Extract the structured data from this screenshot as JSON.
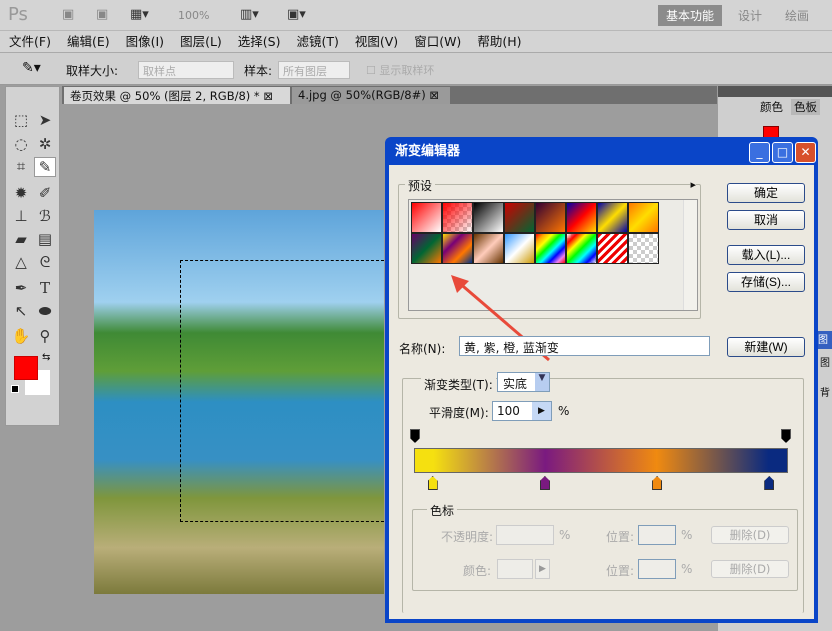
{
  "topbar": {
    "logo": "Ps",
    "zoom": "100%",
    "workspaces": [
      "基本功能",
      "设计",
      "绘画"
    ]
  },
  "menu": [
    "文件(F)",
    "编辑(E)",
    "图像(I)",
    "图层(L)",
    "选择(S)",
    "滤镜(T)",
    "视图(V)",
    "窗口(W)",
    "帮助(H)"
  ],
  "options": {
    "sample_size_label": "取样大小:",
    "sample_size_value": "取样点",
    "sample_label": "样本:",
    "sample_value": "所有图层",
    "show_ring_label": "显示取样环"
  },
  "tabs": [
    {
      "label": "卷页效果 @ 50% (图层 2, RGB/8) *"
    },
    {
      "label": "4.jpg @ 50%(RGB/8#)"
    }
  ],
  "right_panel": {
    "tabs": [
      "颜色",
      "色板"
    ],
    "layers_glyphs": [
      "图",
      "图",
      "背"
    ]
  },
  "colors": {
    "foreground": "#ff0000",
    "background": "#ffffff",
    "title_bar": "#0a45c8"
  },
  "dialog": {
    "title": "渐变编辑器",
    "presets_label": "预设",
    "buttons": {
      "ok": "确定",
      "cancel": "取消",
      "load": "载入(L)...",
      "save": "存储(S)...",
      "new": "新建(W)"
    },
    "name_label": "名称(N):",
    "name_value": "黄, 紫, 橙, 蓝渐变",
    "type_label": "渐变类型(T):",
    "type_value": "实底",
    "smooth_label": "平滑度(M):",
    "smooth_value": "100",
    "percent": "%",
    "stops_group": "色标",
    "opacity_label": "不透明度:",
    "color_label": "颜色:",
    "location_label": "位置:",
    "delete_label": "删除(D)",
    "gradient_stops": [
      {
        "color": "#f5e010",
        "position": 5
      },
      {
        "color": "#7a1a80",
        "position": 35
      },
      {
        "color": "#f08a10",
        "position": 65
      },
      {
        "color": "#0a2a80",
        "position": 95
      }
    ]
  }
}
